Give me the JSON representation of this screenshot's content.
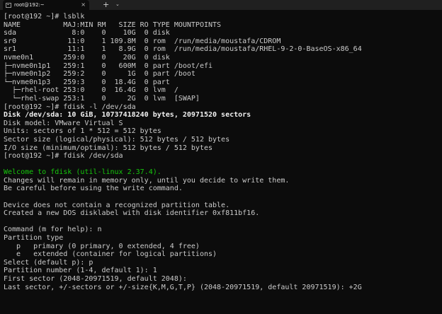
{
  "window": {
    "tab_title": "root@192:~",
    "tab_close": "×",
    "new_tab": "+",
    "dropdown": "⌄"
  },
  "terminal_lines": [
    {
      "text": "[root@192 ~]# lsblk",
      "style": ""
    },
    {
      "text": "NAME          MAJ:MIN RM   SIZE RO TYPE MOUNTPOINTS",
      "style": ""
    },
    {
      "text": "sda             8:0    0    10G  0 disk",
      "style": ""
    },
    {
      "text": "sr0            11:0    1 109.8M  0 rom  /run/media/moustafa/CDROM",
      "style": ""
    },
    {
      "text": "sr1            11:1    1   8.9G  0 rom  /run/media/moustafa/RHEL-9-2-0-BaseOS-x86_64",
      "style": ""
    },
    {
      "text": "nvme0n1       259:0    0    20G  0 disk",
      "style": ""
    },
    {
      "text": "├─nvme0n1p1   259:1    0   600M  0 part /boot/efi",
      "style": ""
    },
    {
      "text": "├─nvme0n1p2   259:2    0     1G  0 part /boot",
      "style": ""
    },
    {
      "text": "└─nvme0n1p3   259:3    0  18.4G  0 part",
      "style": ""
    },
    {
      "text": "  ├─rhel-root 253:0    0  16.4G  0 lvm  /",
      "style": ""
    },
    {
      "text": "  └─rhel-swap 253:1    0     2G  0 lvm  [SWAP]",
      "style": ""
    },
    {
      "text": "[root@192 ~]# fdisk -l /dev/sda",
      "style": ""
    },
    {
      "text": "Disk /dev/sda: 10 GiB, 10737418240 bytes, 20971520 sectors",
      "style": "bold"
    },
    {
      "text": "Disk model: VMware Virtual S",
      "style": ""
    },
    {
      "text": "Units: sectors of 1 * 512 = 512 bytes",
      "style": ""
    },
    {
      "text": "Sector size (logical/physical): 512 bytes / 512 bytes",
      "style": ""
    },
    {
      "text": "I/O size (minimum/optimal): 512 bytes / 512 bytes",
      "style": ""
    },
    {
      "text": "[root@192 ~]# fdisk /dev/sda",
      "style": ""
    },
    {
      "text": "",
      "style": ""
    },
    {
      "text": "Welcome to fdisk (util-linux 2.37.4).",
      "style": "green"
    },
    {
      "text": "Changes will remain in memory only, until you decide to write them.",
      "style": ""
    },
    {
      "text": "Be careful before using the write command.",
      "style": ""
    },
    {
      "text": "",
      "style": ""
    },
    {
      "text": "Device does not contain a recognized partition table.",
      "style": ""
    },
    {
      "text": "Created a new DOS disklabel with disk identifier 0xf811bf16.",
      "style": ""
    },
    {
      "text": "",
      "style": ""
    },
    {
      "text": "Command (m for help): n",
      "style": ""
    },
    {
      "text": "Partition type",
      "style": ""
    },
    {
      "text": "   p   primary (0 primary, 0 extended, 4 free)",
      "style": ""
    },
    {
      "text": "   e   extended (container for logical partitions)",
      "style": ""
    },
    {
      "text": "Select (default p): p",
      "style": ""
    },
    {
      "text": "Partition number (1-4, default 1): 1",
      "style": ""
    },
    {
      "text": "First sector (2048-20971519, default 2048):",
      "style": ""
    },
    {
      "text": "Last sector, +/-sectors or +/-size{K,M,G,T,P} (2048-20971519, default 20971519): +2G",
      "style": ""
    }
  ]
}
